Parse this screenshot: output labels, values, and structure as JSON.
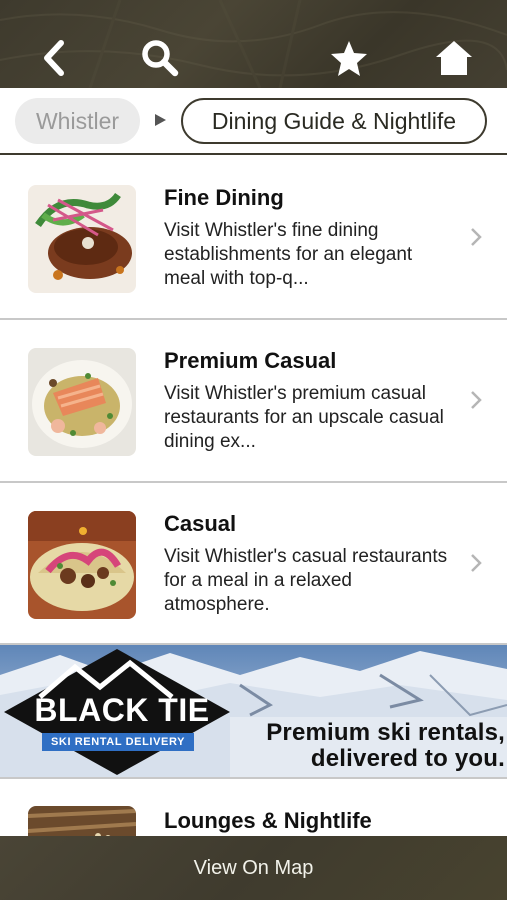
{
  "header": {
    "icons": [
      "back-arrow-icon",
      "search-icon",
      "star-icon",
      "home-icon"
    ],
    "bar_color": "#3e3a2d"
  },
  "breadcrumb": {
    "root": "Whistler",
    "current": "Dining Guide & Nightlife"
  },
  "list": [
    {
      "title": "Fine Dining",
      "description": "Visit Whistler's fine dining establishments for an elegant meal with top-q..."
    },
    {
      "title": "Premium Casual",
      "description": "Visit Whistler's premium casual restaurants for an upscale casual dining ex..."
    },
    {
      "title": "Casual",
      "description": "Visit Whistler's casual restaurants for a meal in a relaxed atmosphere."
    },
    {
      "title": "Lounges & Nightlife"
    }
  ],
  "ad": {
    "brand": "BLACK TIE",
    "tagline": "SKI RENTAL DELIVERY",
    "line1": "Premium ski rentals,",
    "line2": "delivered to you.",
    "accent": "#2f6fc4"
  },
  "footer": {
    "map_button": "View On Map"
  }
}
